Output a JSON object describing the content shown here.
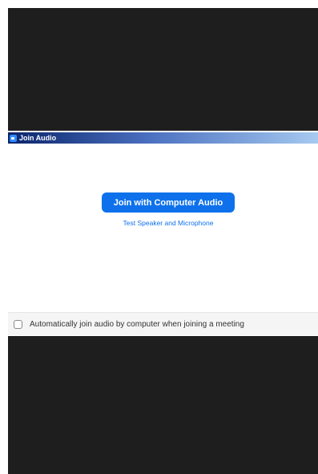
{
  "dialog": {
    "title": "Join Audio",
    "title_icon": "zoom-app-icon"
  },
  "main": {
    "join_button_label": "Join with Computer Audio",
    "test_link_label": "Test Speaker and Microphone"
  },
  "footer": {
    "auto_join_label": "Automatically join audio by computer when joining a meeting",
    "auto_join_checked": false
  },
  "colors": {
    "accent": "#0e71eb",
    "background_dark": "#1e1e1e",
    "titlebar_start": "#0a246a",
    "titlebar_end": "#a6caf0"
  }
}
